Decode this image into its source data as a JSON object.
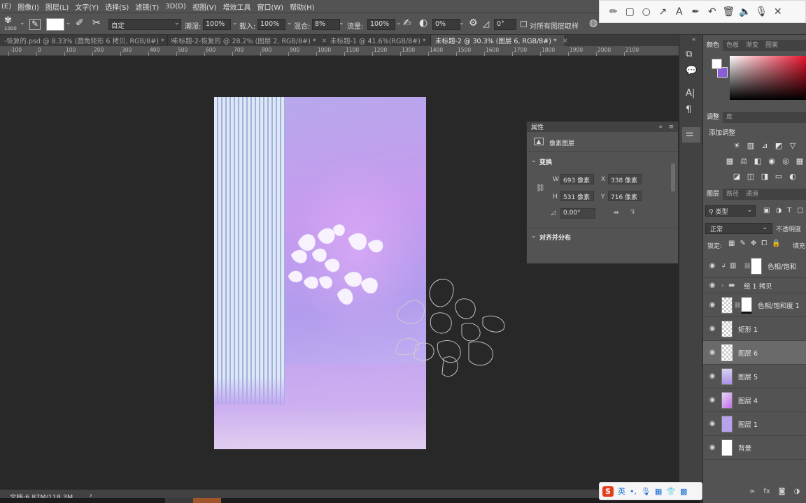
{
  "menubar": [
    "(E)",
    "图像(I)",
    "图层(L)",
    "文字(Y)",
    "选择(S)",
    "滤镜(T)",
    "3D(D)",
    "视图(V)",
    "增效工具",
    "窗口(W)",
    "帮助(H)"
  ],
  "options": {
    "brush_size": "1000",
    "preset": "自定",
    "wet_label": "潮湿:",
    "wet_value": "100%",
    "load_label": "载入:",
    "load_value": "100%",
    "mix_label": "混合:",
    "mix_value": "8%",
    "flow_label": "流量:",
    "flow_value": "100%",
    "smooth_value": "0%",
    "angle_value": "0°",
    "sample_all_label": "对所有图层取样"
  },
  "tabs": [
    {
      "label": "-恢复的.psd @ 8.33% (圆角矩形 6 拷贝, RGB/8#) *",
      "close": "×"
    },
    {
      "label": "未标题-2-恢复的 @ 28.2% (图层 2, RGB/8#) *",
      "close": "×"
    },
    {
      "label": "未标题-1 @ 41.6%(RGB/8#) *",
      "close": "×"
    },
    {
      "label": "未标题-2 @ 30.3% (图层 6, RGB/8#) *",
      "close": "×"
    }
  ],
  "ruler_labels": [
    "-100",
    "0",
    "100",
    "200",
    "300",
    "400",
    "500",
    "600",
    "700",
    "800",
    "900",
    "1000",
    "1100",
    "1200",
    "1300",
    "1400",
    "1500",
    "1600",
    "1700",
    "1800",
    "1900",
    "2000",
    "2100"
  ],
  "properties": {
    "title": "属性",
    "layer_type": "像素图层",
    "transform_label": "变换",
    "w_label": "W",
    "w_value": "693 像素",
    "x_label": "X",
    "x_value": "338 像素",
    "h_label": "H",
    "h_value": "531 像素",
    "y_label": "Y",
    "y_value": "716 像素",
    "angle_value": "0.00°",
    "align_label": "对齐并分布"
  },
  "right": {
    "color_tabs": [
      "颜色",
      "色板",
      "渐变",
      "图案"
    ],
    "adjust_tabs": [
      "调整",
      "库"
    ],
    "add_adjust": "添加调整",
    "layers_tabs": [
      "图层",
      "路径",
      "通道"
    ],
    "filter_kind": "类型",
    "blend_mode": "正常",
    "opacity_label": "不透明度",
    "lock_label": "锁定:",
    "fill_label": "填充",
    "layers": [
      {
        "name": "色相/饱和",
        "type": "adjust"
      },
      {
        "name": "组 1 拷贝",
        "type": "group"
      },
      {
        "name": "色相/饱和度 1",
        "type": "adjust"
      },
      {
        "name": "矩形 1",
        "type": "shape"
      },
      {
        "name": "图层 6",
        "type": "pixel",
        "selected": true
      },
      {
        "name": "图层 5",
        "type": "pixel"
      },
      {
        "name": "图层 4",
        "type": "pixel"
      },
      {
        "name": "图层 1",
        "type": "pixel"
      },
      {
        "name": "背景",
        "type": "background"
      }
    ]
  },
  "status": {
    "doc_info": "文档:6.87M/118.3M"
  },
  "ime": {
    "label": "英"
  },
  "colors": {
    "foreground": "#ffffff",
    "background": "#8a5dd8",
    "doc_purple": "#c79bf0"
  }
}
